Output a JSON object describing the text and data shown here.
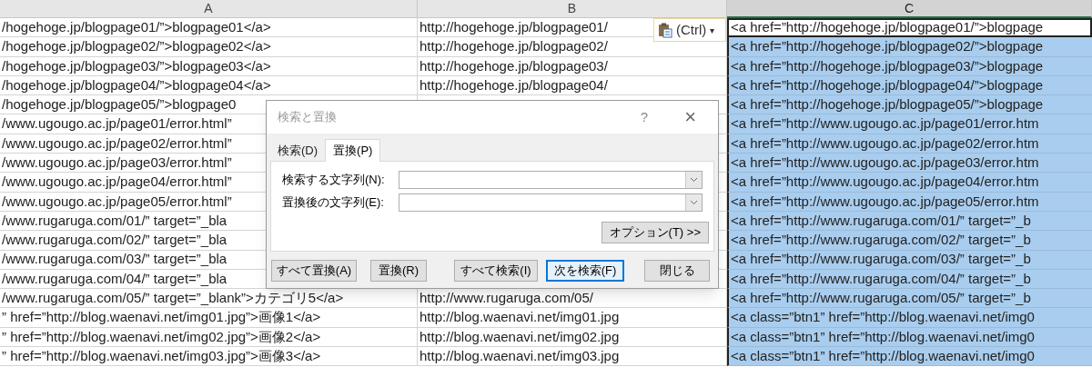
{
  "columns": [
    {
      "label": "A",
      "selected": false
    },
    {
      "label": "B",
      "selected": false
    },
    {
      "label": "C",
      "selected": true
    }
  ],
  "rows": [
    {
      "a": "/hogehoge.jp/blogpage01/”>blogpage01</a>",
      "b": "http://hogehoge.jp/blogpage01/",
      "c": {
        "text": "<a href=”http://hogehoge.jp/blogpage01/”>blogpage",
        "selected": false,
        "active": true
      }
    },
    {
      "a": "/hogehoge.jp/blogpage02/”>blogpage02</a>",
      "b": "http://hogehoge.jp/blogpage02/",
      "c": {
        "text": "<a href=”http://hogehoge.jp/blogpage02/”>blogpage",
        "selected": true,
        "active": false
      }
    },
    {
      "a": "/hogehoge.jp/blogpage03/”>blogpage03</a>",
      "b": "http://hogehoge.jp/blogpage03/",
      "c": {
        "text": "<a href=”http://hogehoge.jp/blogpage03/”>blogpage",
        "selected": true,
        "active": false
      }
    },
    {
      "a": "/hogehoge.jp/blogpage04/”>blogpage04</a>",
      "b": "http://hogehoge.jp/blogpage04/",
      "c": {
        "text": "<a href=”http://hogehoge.jp/blogpage04/”>blogpage",
        "selected": true,
        "active": false
      }
    },
    {
      "a": "/hogehoge.jp/blogpage05/”>blogpage0",
      "c": {
        "text": "<a href=”http://hogehoge.jp/blogpage05/”>blogpage",
        "selected": true,
        "active": false
      }
    },
    {
      "a": "/www.ugougo.ac.jp/page01/error.html”",
      "c": {
        "text": "<a href=”http://www.ugougo.ac.jp/page01/error.htm",
        "selected": true,
        "active": false
      }
    },
    {
      "a": "/www.ugougo.ac.jp/page02/error.html”",
      "c": {
        "text": "<a href=”http://www.ugougo.ac.jp/page02/error.htm",
        "selected": true,
        "active": false
      }
    },
    {
      "a": "/www.ugougo.ac.jp/page03/error.html”",
      "c": {
        "text": "<a href=”http://www.ugougo.ac.jp/page03/error.htm",
        "selected": true,
        "active": false
      }
    },
    {
      "a": "/www.ugougo.ac.jp/page04/error.html”",
      "c": {
        "text": "<a href=”http://www.ugougo.ac.jp/page04/error.htm",
        "selected": true,
        "active": false
      }
    },
    {
      "a": "/www.ugougo.ac.jp/page05/error.html”",
      "c": {
        "text": "<a href=”http://www.ugougo.ac.jp/page05/error.htm",
        "selected": true,
        "active": false
      }
    },
    {
      "a": "/www.rugaruga.com/01/”  target=”_bla",
      "c": {
        "text": "<a href=”http://www.rugaruga.com/01/”  target=”_b",
        "selected": true,
        "active": false
      }
    },
    {
      "a": "/www.rugaruga.com/02/”  target=”_bla",
      "c": {
        "text": "<a href=”http://www.rugaruga.com/02/”  target=”_b",
        "selected": true,
        "active": false
      }
    },
    {
      "a": "/www.rugaruga.com/03/”  target=”_bla",
      "c": {
        "text": "<a href=”http://www.rugaruga.com/03/”  target=”_b",
        "selected": true,
        "active": false
      }
    },
    {
      "a": "/www.rugaruga.com/04/”  target=”_bla",
      "c": {
        "text": "<a href=”http://www.rugaruga.com/04/”  target=”_b",
        "selected": true,
        "active": false
      }
    },
    {
      "a": "/www.rugaruga.com/05/”  target=”_blank”>カテゴリ5</a>",
      "b": "http://www.rugaruga.com/05/",
      "c": {
        "text": "<a href=”http://www.rugaruga.com/05/”  target=”_b",
        "selected": true,
        "active": false
      }
    },
    {
      "a": "”  href=”http://blog.waenavi.net/img01.jpg”>画像1</a>",
      "b": "http://blog.waenavi.net/img01.jpg",
      "c": {
        "text": "<a class=”btn1”  href=”http://blog.waenavi.net/img0",
        "selected": true,
        "active": false
      }
    },
    {
      "a": "”  href=”http://blog.waenavi.net/img02.jpg”>画像2</a>",
      "b": "http://blog.waenavi.net/img02.jpg",
      "c": {
        "text": "<a class=”btn1”  href=”http://blog.waenavi.net/img0",
        "selected": true,
        "active": false
      }
    },
    {
      "a": "”  href=”http://blog.waenavi.net/img03.jpg”>画像3</a>",
      "b": "http://blog.waenavi.net/img03.jpg",
      "c": {
        "text": "<a class=”btn1”  href=”http://blog.waenavi.net/img0",
        "selected": true,
        "active": false
      }
    }
  ],
  "paste_options": {
    "label": "(Ctrl)",
    "caret": "▾"
  },
  "dialog": {
    "title": "検索と置換",
    "help": "?",
    "close": "×",
    "tabs": [
      {
        "label": "検索(D)",
        "selected": false
      },
      {
        "label": "置換(P)",
        "selected": true
      }
    ],
    "fields": [
      {
        "label": "検索する文字列(N):"
      },
      {
        "label": "置換後の文字列(E):"
      }
    ],
    "options_button": "オプション(T) >>",
    "buttons": [
      {
        "label": "すべて置換(A)",
        "default": false
      },
      {
        "label": "置換(R)",
        "default": false
      },
      {
        "label": "すべて検索(I)",
        "default": false
      },
      {
        "label": "次を検索(F)",
        "default": true
      },
      {
        "label": "閉じる",
        "default": false
      }
    ]
  }
}
